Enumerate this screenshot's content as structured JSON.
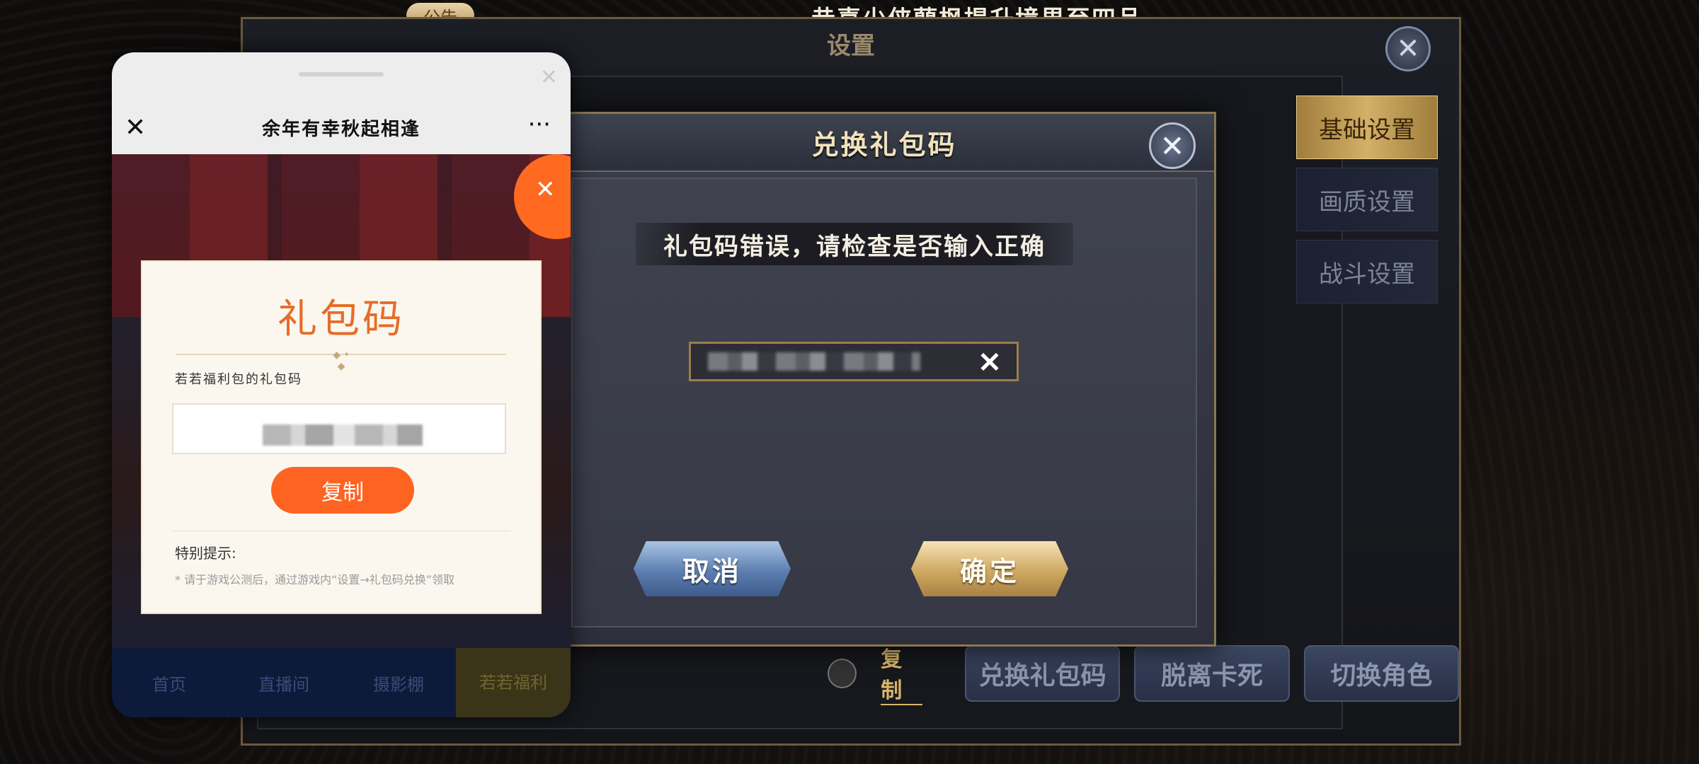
{
  "top": {
    "notice_label": "公告",
    "congrats_text": "恭喜少侠蔄枫提升境界至四品"
  },
  "settings": {
    "title": "设置",
    "close_symbol": "✕",
    "tabs": [
      {
        "label": "基础设置",
        "active": true
      },
      {
        "label": "画质设置",
        "active": false
      },
      {
        "label": "战斗设置",
        "active": false
      }
    ],
    "copy_label": "复制",
    "bottom_buttons": [
      "兑换礼包码",
      "脱离卡死",
      "切换角色"
    ]
  },
  "redeem_dialog": {
    "title": "兑换礼包码",
    "close_symbol": "✕",
    "error_message": "礼包码错误，请检查是否输入正确",
    "clear_symbol": "✕",
    "cancel_label": "取消",
    "confirm_label": "确定"
  },
  "webview": {
    "title": "余年有幸秋起相逢",
    "close_symbol": "✕",
    "more_symbol": "···",
    "minimize_symbol": "✕",
    "page_close_symbol": "✕",
    "nav": [
      {
        "label": "首页",
        "active": false
      },
      {
        "label": "直播间",
        "active": false
      },
      {
        "label": "摄影棚",
        "active": false
      },
      {
        "label": "若若福利",
        "active": true
      }
    ],
    "gift_card": {
      "title": "礼包码",
      "divider_ornament": "◆ • ◆",
      "label": "若若福利包的礼包码",
      "copy_button": "复制",
      "tip_title": "特别提示:",
      "tip_text": "* 请于游戏公测后，通过游戏内“设置→礼包码兑换”领取"
    }
  },
  "colors": {
    "accent_orange": "#ff6321",
    "gold_border": "#8c7651",
    "confirm_gold": "#cfa861",
    "cancel_blue": "#5c7fb0"
  }
}
